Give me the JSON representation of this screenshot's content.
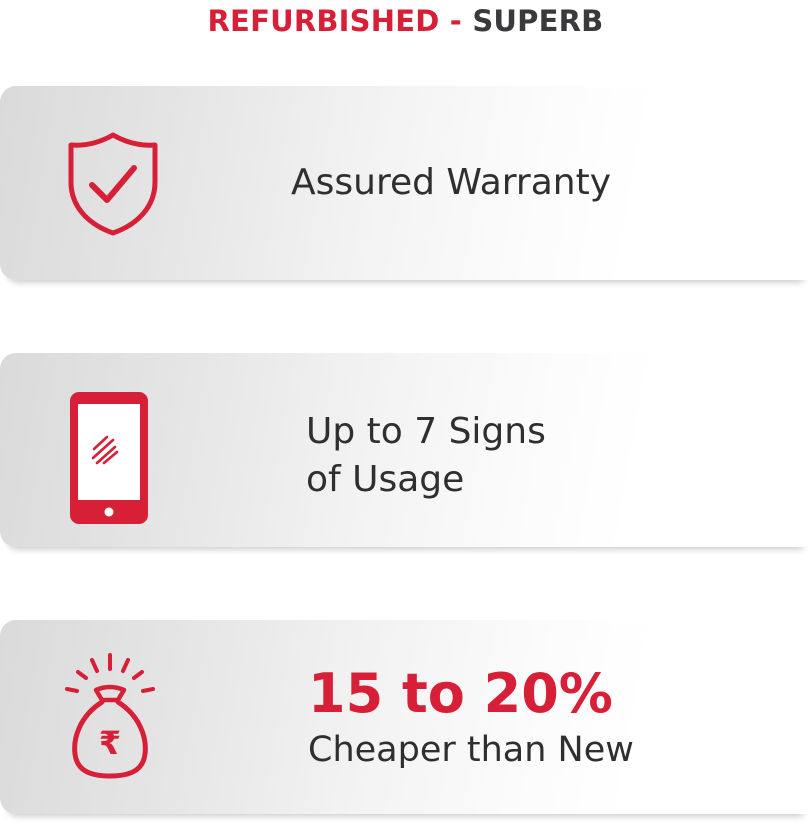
{
  "header": {
    "title_accent": "REFURBISHED -",
    "title_rest": "SUPERB"
  },
  "colors": {
    "accent": "#d71f37",
    "text_dark": "#2f2f31"
  },
  "features": [
    {
      "icon": "shield-check-icon",
      "text": "Assured Warranty"
    },
    {
      "icon": "phone-scratch-icon",
      "line1": "Up to 7 Signs",
      "line2": "of Usage"
    },
    {
      "icon": "money-bag-rupee-icon",
      "highlight": "15 to 20%",
      "text": "Cheaper than New",
      "symbol": "₹"
    }
  ]
}
